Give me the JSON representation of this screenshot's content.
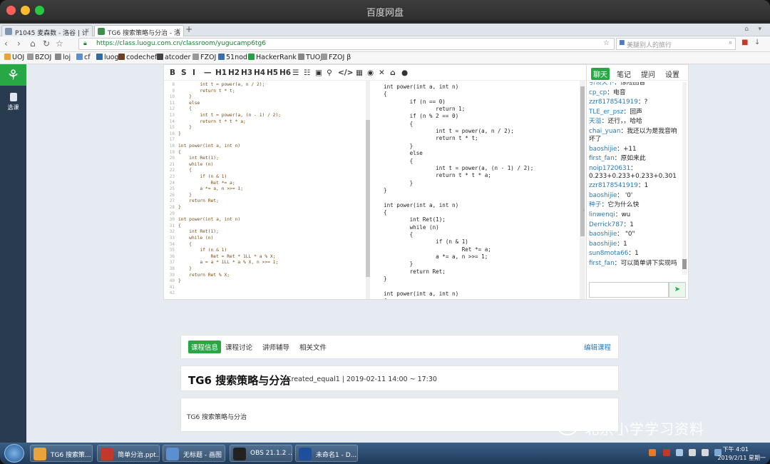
{
  "window": {
    "title": "百度网盘"
  },
  "browser": {
    "tabs": [
      {
        "label": "P1045 麦森数 - 洛谷 | 计",
        "color": "#7f95b0"
      },
      {
        "label": "TG6 搜索策略与分治 - 洛",
        "color": "#3f8f4f"
      }
    ],
    "url": "https://class.luogu.com.cn/classroom/yugucamp6tg6",
    "search_placeholder": "美腿别人的旅行",
    "bookmarks": [
      "UOJ",
      "BZOJ",
      "loj",
      "cf",
      "luogu",
      "codechef",
      "atcoder",
      "FZOJ",
      "51nod",
      "HackerRank",
      "TUOJ",
      "FZOJ β"
    ]
  },
  "sidebar": {
    "logo": "𐀪",
    "item": "选课"
  },
  "editor": {
    "toolbar": [
      "B",
      "S",
      "I",
      "—",
      "H1",
      "H2",
      "H3",
      "H4",
      "H5",
      "H6",
      "☰",
      "☷",
      "▣",
      "⚲",
      "</>",
      "▦",
      "◉",
      "✕",
      "⌂",
      "●"
    ],
    "left_lines": [
      {
        "n": "8",
        "t": "        int t = power(a, n / 2);"
      },
      {
        "n": "9",
        "t": "        return t * t;"
      },
      {
        "n": "10",
        "t": "    }"
      },
      {
        "n": "11",
        "t": "    else"
      },
      {
        "n": "12",
        "t": "    {"
      },
      {
        "n": "13",
        "t": "        int t = power(a, (n - 1) / 2);"
      },
      {
        "n": "14",
        "t": "        return t * t * a;"
      },
      {
        "n": "15",
        "t": "    }"
      },
      {
        "n": "16",
        "t": "}"
      },
      {
        "n": "17",
        "t": ""
      },
      {
        "n": "18",
        "t": "int power(int a, int n)"
      },
      {
        "n": "19",
        "t": "{"
      },
      {
        "n": "20",
        "t": "    int Ret(1);"
      },
      {
        "n": "21",
        "t": "    while (n)"
      },
      {
        "n": "22",
        "t": "    {"
      },
      {
        "n": "23",
        "t": "        if (n & 1)"
      },
      {
        "n": "24",
        "t": "            Ret *= a;"
      },
      {
        "n": "25",
        "t": "        a *= a, n >>= 1;"
      },
      {
        "n": "26",
        "t": "    }"
      },
      {
        "n": "27",
        "t": "    return Ret;"
      },
      {
        "n": "28",
        "t": "}"
      },
      {
        "n": "29",
        "t": ""
      },
      {
        "n": "30",
        "t": "int power(int a, int n)"
      },
      {
        "n": "31",
        "t": "{"
      },
      {
        "n": "32",
        "t": "    int Ret(1);"
      },
      {
        "n": "33",
        "t": "    while (n)"
      },
      {
        "n": "34",
        "t": "    {"
      },
      {
        "n": "35",
        "t": "        if (n & 1)"
      },
      {
        "n": "36",
        "t": "            Ret = Ret * 1LL * a % X;"
      },
      {
        "n": "37",
        "t": "        a = a * 1LL * a % X, n >>= 1;"
      },
      {
        "n": "38",
        "t": "    }"
      },
      {
        "n": "39",
        "t": "    return Ret % X;"
      },
      {
        "n": "40",
        "t": "}"
      },
      {
        "n": "41",
        "t": ""
      },
      {
        "n": "42",
        "t": ""
      }
    ],
    "right_lines": [
      "int power(int a, int n)",
      "{",
      "        if (n == 0)",
      "                return 1;",
      "        if (n % 2 == 0)",
      "        {",
      "                int t = power(a, n / 2);",
      "                return t * t;",
      "        }",
      "        else",
      "        {",
      "                int t = power(a, (n - 1) / 2);",
      "                return t * t * a;",
      "        }",
      "}",
      "",
      "int power(int a, int n)",
      "{",
      "        int Ret(1);",
      "        while (n)",
      "        {",
      "                if (n & 1)",
      "                        Ret *= a;",
      "                a *= a, n >>= 1;",
      "        }",
      "        return Ret;",
      "}",
      "",
      "int power(int a, int n)",
      "{"
    ]
  },
  "chat": {
    "tabs": [
      "聊天",
      "笔记",
      "提问",
      "设置"
    ],
    "messages": [
      {
        "u": "引领天下",
        "m": "：惊险回音"
      },
      {
        "u": "cp_cp",
        "m": "：电音"
      },
      {
        "u": "zzr8178541919",
        "m": "：?"
      },
      {
        "u": "TLE_er_psz",
        "m": "：回声"
      },
      {
        "u": "天溢",
        "m": "：还行，，哈哈"
      },
      {
        "u": "chai_yuan",
        "m": "：我还以为是我音响坏了"
      },
      {
        "u": "baoshijie",
        "m": "：+11"
      },
      {
        "u": "first_fan",
        "m": "：原如来此"
      },
      {
        "u": "noip1720631",
        "m": "：0.233+0.233+0.233+0.301"
      },
      {
        "u": "zzr8178541919",
        "m": "：1"
      },
      {
        "u": "baoshijie",
        "m": "：  '0'"
      },
      {
        "u": "种子",
        "m": "：它为什么快"
      },
      {
        "u": "linwenqi",
        "m": "：wu"
      },
      {
        "u": "Derrick787",
        "m": "：1"
      },
      {
        "u": "baoshijie",
        "m": "：  \"0\""
      },
      {
        "u": "baoshijie",
        "m": "：1"
      },
      {
        "u": "sun8mota66",
        "m": "：1"
      },
      {
        "u": "first_fan",
        "m": "：可以简单讲下实现吗"
      }
    ],
    "send": "➤"
  },
  "course": {
    "tabs": [
      "课程信息",
      "课程讨论",
      "讲师辅导",
      "相关文件"
    ],
    "edit": "编辑课程",
    "title": "TG6 搜索策略与分治",
    "meta": "Created_equal1 | 2019-02-11 14:00 ~ 17:30",
    "description": "TG6 搜索策略与分治"
  },
  "watermark": "北京小学学习资料",
  "taskbar": {
    "items": [
      {
        "label": "TG6 搜索策...",
        "color": "#e8a33a"
      },
      {
        "label": "简单分治.ppt...",
        "color": "#c0392b"
      },
      {
        "label": "无标题 - 画图",
        "color": "#5b8fd0"
      },
      {
        "label": "OBS 21.1.2 ...",
        "color": "#222222"
      },
      {
        "label": "未命名1 - D...",
        "color": "#1f4f9a"
      }
    ],
    "time": "下午 4:01",
    "date": "2019/2/11 星期一"
  }
}
